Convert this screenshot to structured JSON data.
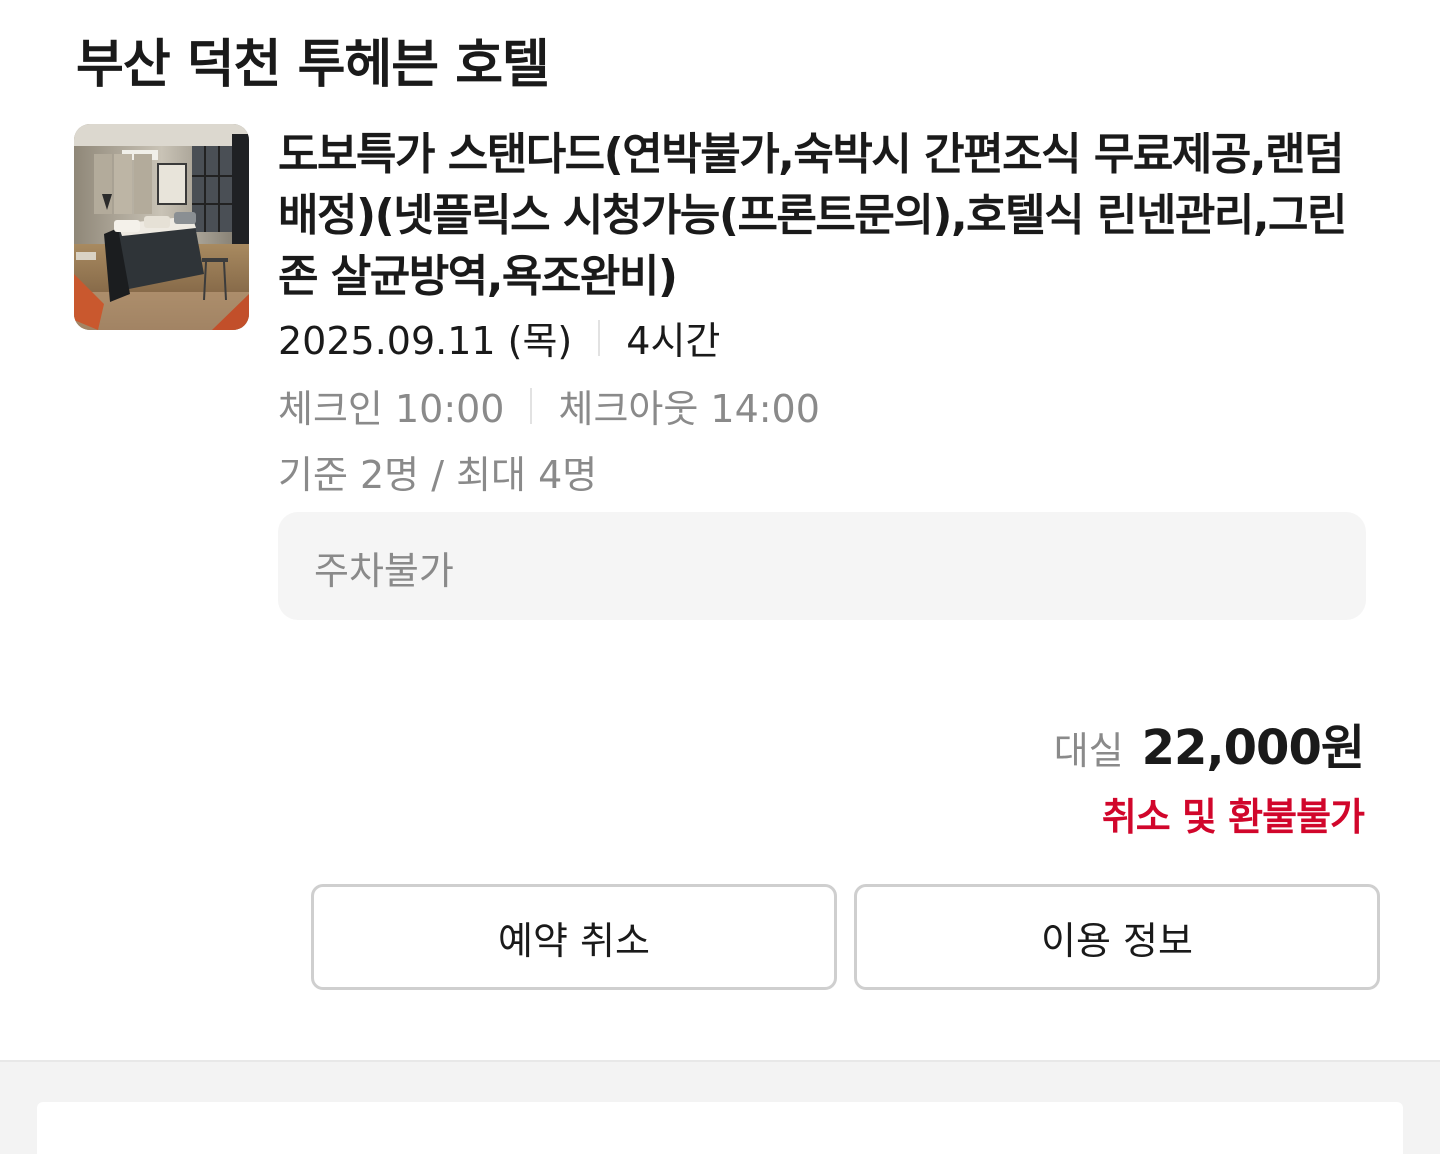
{
  "reservation": {
    "hotel_name": "부산 덕천 투헤븐 호텔",
    "room_image_icon": "room-photo",
    "room_title": "도보특가 스탠다드(연박불가,숙박시 간편조식 무료제공,랜덤배정)(넷플릭스 시청가능(프론트문의),호텔식 린넨관리,그린존 살균방역,욕조완비)",
    "date": "2025.09.11 (목)",
    "duration": "4시간",
    "check_in": "체크인 10:00",
    "check_out": "체크아웃 14:00",
    "capacity": "기준 2명 / 최대 4명",
    "notice": "주차불가",
    "price_label": "대실",
    "price_value": "22,000원",
    "refund_policy": "취소 및 환불불가",
    "cancel_button": "예약 취소",
    "info_button": "이용 정보"
  },
  "colors": {
    "text_primary": "#1a1a1a",
    "text_secondary": "#8a8a8a",
    "refund_red": "#d1062b",
    "notice_bg": "#f5f5f5",
    "button_border": "#cfcfcf"
  }
}
